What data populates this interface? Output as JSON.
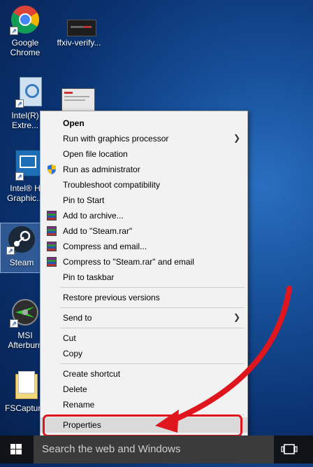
{
  "desktop": {
    "icons": [
      {
        "label": "Google Chrome",
        "icon": "chrome-icon"
      },
      {
        "label": "ffxiv-verify...",
        "icon": "ffxiv-thumbnail"
      },
      {
        "label": "Intel(R) Extre...",
        "icon": "intel-tuning-icon"
      },
      {
        "label": "Intel® H Graphic...",
        "icon": "intel-graphics-icon"
      },
      {
        "label": "Steam",
        "icon": "steam-icon"
      },
      {
        "label": "MSI Afterburn",
        "icon": "msi-afterburner-icon"
      },
      {
        "label": "FSCapture",
        "icon": "fscapture-folder-icon"
      }
    ]
  },
  "context_menu": {
    "items": [
      {
        "label": "Open",
        "bold": true
      },
      {
        "label": "Run with graphics processor",
        "submenu": true
      },
      {
        "label": "Open file location"
      },
      {
        "label": "Run as administrator",
        "icon": "uac-shield-icon"
      },
      {
        "label": "Troubleshoot compatibility"
      },
      {
        "label": "Pin to Start"
      },
      {
        "label": "Add to archive...",
        "icon": "winrar-icon"
      },
      {
        "label": "Add to \"Steam.rar\"",
        "icon": "winrar-icon"
      },
      {
        "label": "Compress and email...",
        "icon": "winrar-icon"
      },
      {
        "label": "Compress to \"Steam.rar\" and email",
        "icon": "winrar-icon"
      },
      {
        "label": "Pin to taskbar"
      },
      {
        "label": "Restore previous versions"
      },
      {
        "label": "Send to",
        "submenu": true
      },
      {
        "label": "Cut"
      },
      {
        "label": "Copy"
      },
      {
        "label": "Create shortcut"
      },
      {
        "label": "Delete"
      },
      {
        "label": "Rename"
      },
      {
        "label": "Properties",
        "highlighted": true
      }
    ]
  },
  "annotation": {
    "color": "#e0161f"
  },
  "taskbar": {
    "search_placeholder": "Search the web and Windows",
    "start_icon": "windows-logo-icon",
    "task_view_icon": "task-view-icon"
  }
}
